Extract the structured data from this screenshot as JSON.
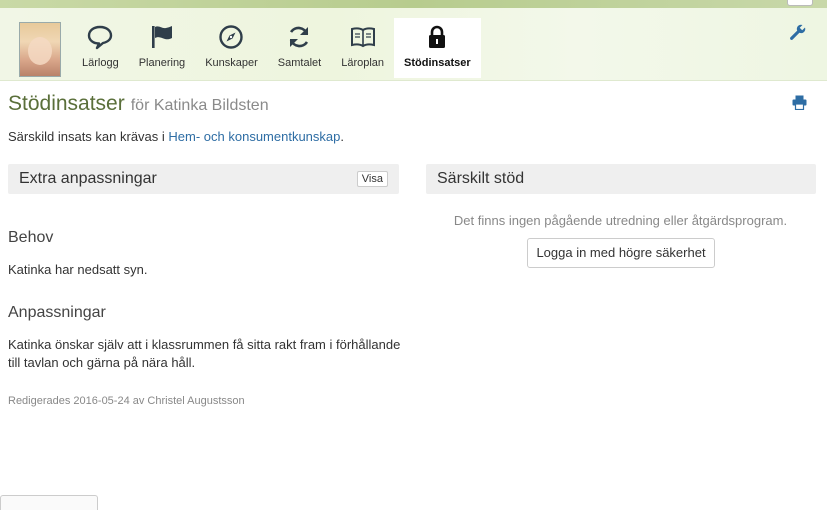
{
  "nav": {
    "items": [
      {
        "label": "Lärlogg",
        "icon": "speech-bubble-icon"
      },
      {
        "label": "Planering",
        "icon": "flag-icon"
      },
      {
        "label": "Kunskaper",
        "icon": "compass-icon"
      },
      {
        "label": "Samtalet",
        "icon": "refresh-icon"
      },
      {
        "label": "Läroplan",
        "icon": "open-book-icon"
      },
      {
        "label": "Stödinsatser",
        "icon": "lock-icon",
        "active": true
      }
    ]
  },
  "header": {
    "title": "Stödinsatser",
    "subtitle": "för Katinka Bildsten"
  },
  "intro": {
    "text": "Särskild insats kan krävas i ",
    "link": "Hem- och konsumentkunskap",
    "suffix": "."
  },
  "extra": {
    "title": "Extra anpassningar",
    "show_button": "Visa",
    "needs_heading": "Behov",
    "needs_text": "Katinka har nedsatt syn.",
    "adaptations_heading": "Anpassningar",
    "adaptations_text": "Katinka önskar själv att i klassrummen få sitta rakt fram i förhållande till tavlan och gärna på nära håll.",
    "edited": "Redigerades 2016-05-24 av Christel Augustsson"
  },
  "special": {
    "title": "Särskilt stöd",
    "none_text": "Det finns ingen pågående utredning eller åtgärdsprogram.",
    "login_button": "Logga in med högre säkerhet"
  },
  "colors": {
    "title_green": "#5a6f3a",
    "link_blue": "#2e6da4",
    "icon_blue": "#2e6da4"
  }
}
